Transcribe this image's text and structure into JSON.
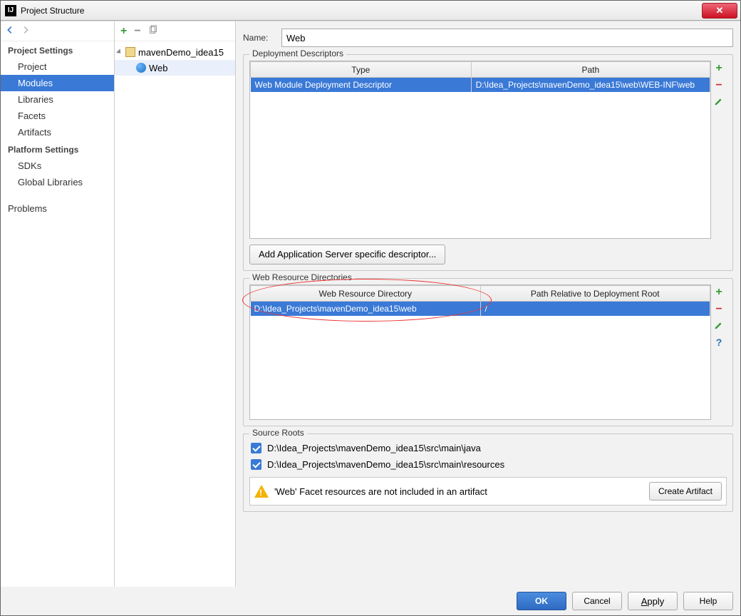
{
  "window": {
    "title": "Project Structure"
  },
  "sidebar": {
    "groups": [
      {
        "title": "Project Settings",
        "items": [
          "Project",
          "Modules",
          "Libraries",
          "Facets",
          "Artifacts"
        ],
        "selected": 1
      },
      {
        "title": "Platform Settings",
        "items": [
          "SDKs",
          "Global Libraries"
        ]
      },
      {
        "title": "",
        "items": [
          "Problems"
        ]
      }
    ]
  },
  "tree": {
    "module": "mavenDemo_idea15",
    "facet": "Web"
  },
  "name": {
    "label": "Name:",
    "value": "Web"
  },
  "deploy": {
    "legend": "Deployment Descriptors",
    "headers": [
      "Type",
      "Path"
    ],
    "row": {
      "type": "Web Module Deployment Descriptor",
      "path": "D:\\Idea_Projects\\mavenDemo_idea15\\web\\WEB-INF\\web"
    },
    "add_btn_prefix": "Add Application ",
    "add_btn_u": "S",
    "add_btn_suffix": "erver specific descriptor..."
  },
  "webres": {
    "legend": "Web Resource Directories",
    "headers": [
      "Web Resource Directory",
      "Path Relative to Deployment Root"
    ],
    "row": {
      "dir": "D:\\Idea_Projects\\mavenDemo_idea15\\web",
      "rel": "/"
    }
  },
  "source": {
    "legend": "Source Roots",
    "entries": [
      "D:\\Idea_Projects\\mavenDemo_idea15\\src\\main\\java",
      "D:\\Idea_Projects\\mavenDemo_idea15\\src\\main\\resources"
    ],
    "warning": "'Web' Facet resources are not included in an artifact",
    "create_btn": "Create Artifact"
  },
  "footer": {
    "ok": "OK",
    "cancel": "Cancel",
    "apply_u": "A",
    "apply_rest": "pply",
    "help": "Help"
  }
}
